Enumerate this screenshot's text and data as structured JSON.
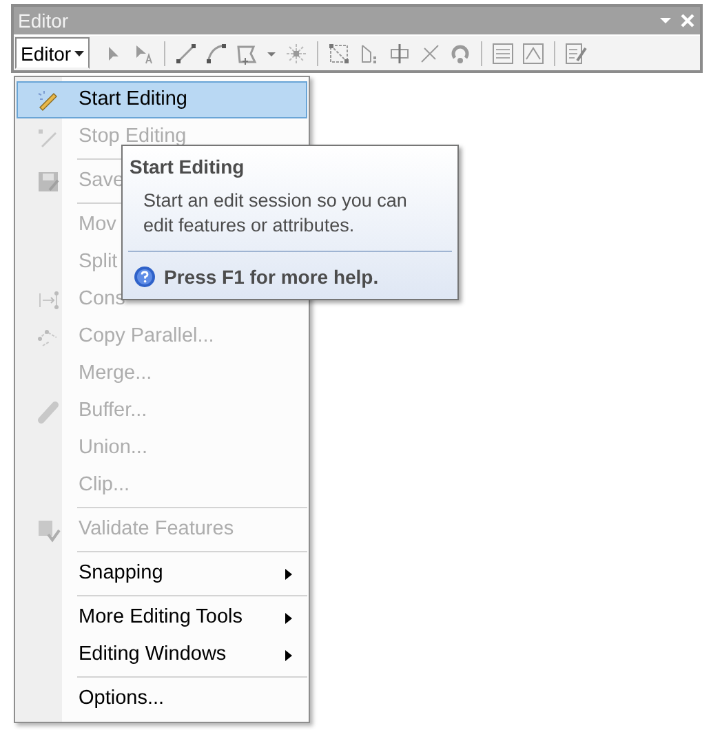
{
  "window": {
    "title": "Editor"
  },
  "toolbar": {
    "editor_menu": {
      "label": "Editor",
      "expanded": true
    }
  },
  "menu": {
    "items": [
      {
        "label": "Start Editing",
        "disabled": false,
        "selected": true,
        "separator_before": false,
        "submenu": false
      },
      {
        "label": "Stop Editing",
        "disabled": true,
        "selected": false,
        "separator_before": false,
        "submenu": false
      },
      {
        "label": "Save",
        "disabled": true,
        "selected": false,
        "separator_before": true,
        "submenu": false
      },
      {
        "label": "Mov",
        "disabled": true,
        "selected": false,
        "separator_before": true,
        "submenu": false
      },
      {
        "label": "Split",
        "disabled": true,
        "selected": false,
        "separator_before": false,
        "submenu": false
      },
      {
        "label": "Cons",
        "disabled": true,
        "selected": false,
        "separator_before": false,
        "submenu": false
      },
      {
        "label": "Copy Parallel...",
        "disabled": true,
        "selected": false,
        "separator_before": false,
        "submenu": false
      },
      {
        "label": "Merge...",
        "disabled": true,
        "selected": false,
        "separator_before": false,
        "submenu": false
      },
      {
        "label": "Buffer...",
        "disabled": true,
        "selected": false,
        "separator_before": false,
        "submenu": false
      },
      {
        "label": "Union...",
        "disabled": true,
        "selected": false,
        "separator_before": false,
        "submenu": false
      },
      {
        "label": "Clip...",
        "disabled": true,
        "selected": false,
        "separator_before": false,
        "submenu": false
      },
      {
        "label": "Validate Features",
        "disabled": true,
        "selected": false,
        "separator_before": true,
        "submenu": false
      },
      {
        "label": "Snapping",
        "disabled": false,
        "selected": false,
        "separator_before": true,
        "submenu": true
      },
      {
        "label": "More Editing Tools",
        "disabled": false,
        "selected": false,
        "separator_before": true,
        "submenu": true
      },
      {
        "label": "Editing Windows",
        "disabled": false,
        "selected": false,
        "separator_before": false,
        "submenu": true
      },
      {
        "label": "Options...",
        "disabled": false,
        "selected": false,
        "separator_before": true,
        "submenu": false
      }
    ]
  },
  "tooltip": {
    "title": "Start Editing",
    "body": "Start an edit session so you can edit features or attributes.",
    "help": "Press F1 for more help."
  }
}
